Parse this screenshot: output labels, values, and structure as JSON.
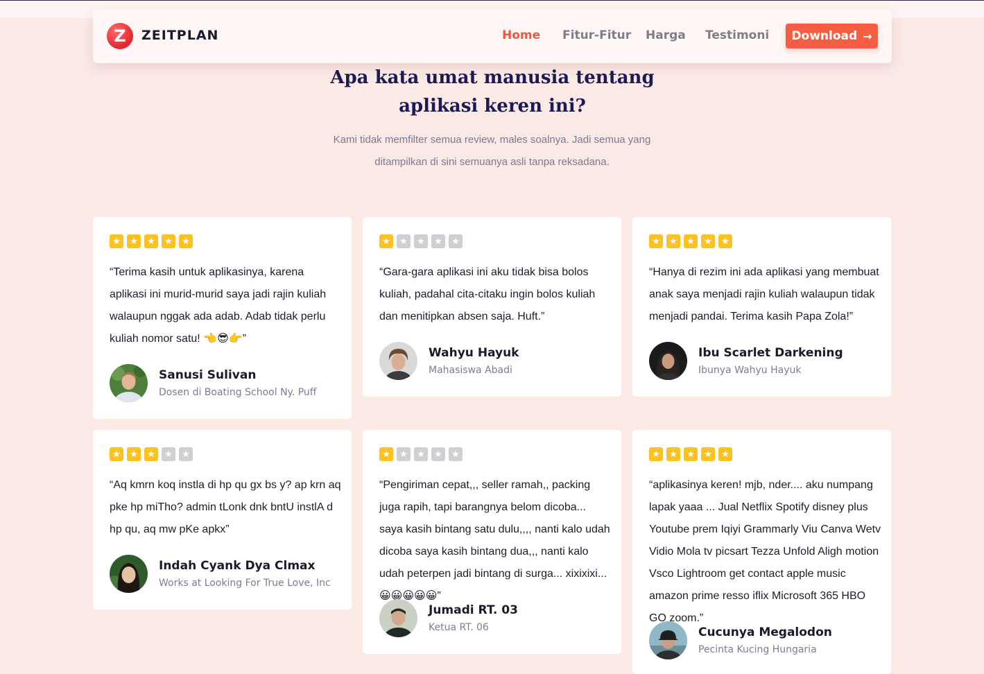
{
  "nav": {
    "brand": "ZEITPLAN",
    "logo_letter": "Z",
    "links": [
      "Home",
      "Fitur-Fitur",
      "Harga",
      "Testimoni"
    ],
    "active_link": "Home",
    "download_label": "Download",
    "download_icon": "arrow-right-icon"
  },
  "section": {
    "title_line1": "Apa kata umat manusia tentang",
    "title_line2": "aplikasi keren ini?",
    "subtitle_line1": "Kami tidak memfilter semua review, males soalnya. Jadi semua yang",
    "subtitle_line2": "ditampilkan di sini semuanya asli tanpa reksadana."
  },
  "colors": {
    "accent": "#f75d41",
    "star_on": "#fcc222",
    "star_off": "#cfcfd4",
    "heading": "#1c1a54",
    "background": "#fbe9e6"
  },
  "testimonials": [
    {
      "rating": 5,
      "quote": "“Terima kasih untuk aplikasinya, karena aplikasi ini murid-murid saya jadi rajin kuliah walaupun nggak ada adab. Adab tidak perlu kuliah nomor satu! 👈😎👉”",
      "name": "Sanusi Sulivan",
      "role": "Dosen di Boating School Ny. Puff"
    },
    {
      "rating": 1,
      "quote": "“Gara-gara aplikasi ini aku tidak bisa bolos kuliah, padahal cita-citaku ingin bolos kuliah dan menitipkan absen saja. Huft.”",
      "name": "Wahyu Hayuk",
      "role": "Mahasiswa Abadi"
    },
    {
      "rating": 5,
      "quote": "“Hanya di rezim ini ada aplikasi yang membuat anak saya menjadi rajin kuliah walaupun tidak menjadi pandai. Terima kasih Papa Zola!”",
      "name": "Ibu Scarlet Darkening",
      "role": "Ibunya Wahyu Hayuk"
    },
    {
      "rating": 3,
      "quote": "“Aq kmrn koq instla di hp qu gx bs y? ap krn aq pke hp miTho? admin tLonk dnk bntU instlA d hp qu, aq mw pKe apkx”",
      "name": "Indah Cyank Dya Clmax",
      "role": "Works at Looking For True Love, Inc"
    },
    {
      "rating": 1,
      "quote": "“Pengiriman cepat,,, seller ramah,, packing juga rapih, tapi barangnya belom dicoba... saya kasih bintang satu dulu,,,, nanti kalo udah dicoba saya kasih bintang dua,,, nanti kalo udah peterpen jadi bintang di surga... xixixixi... 😀😀😀😀😀”",
      "name": "Jumadi RT. 03",
      "role": "Ketua RT. 06"
    },
    {
      "rating": 5,
      "quote": "“aplikasinya keren! mjb, nder.... aku numpang lapak yaaa ... Jual Netflix Spotify disney plus Youtube prem Iqiyi Grammarly Viu Canva Wetv Vidio Mola tv picsart Tezza Unfold Aligh motion Vsco Lightroom get contact apple music amazon prime resso iflix Microsoft 365 HBO GO zoom.”",
      "name": "Cucunya Megalodon",
      "role": "Pecinta Kucing Hungaria"
    }
  ]
}
